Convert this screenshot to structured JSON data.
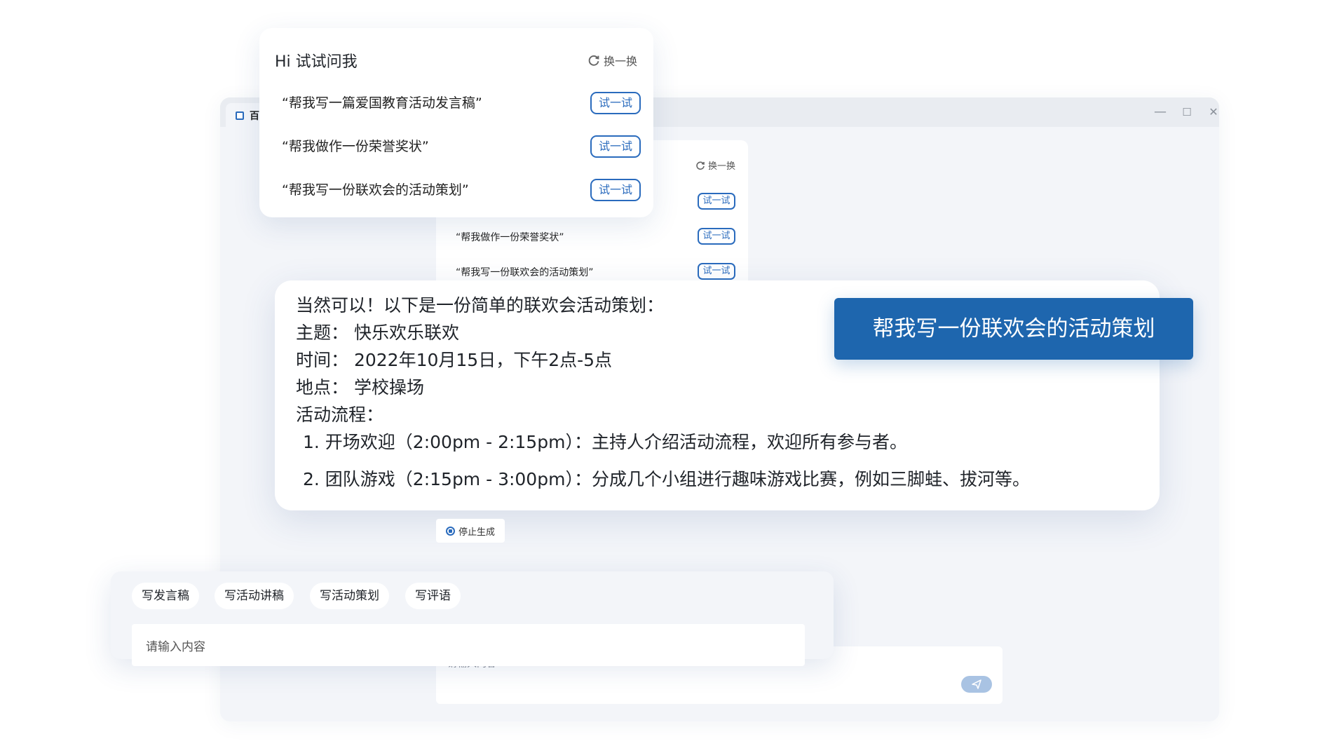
{
  "window": {
    "tab_label": "百",
    "controls": {
      "minimize": "—",
      "maximize": "☐",
      "close": "✕"
    }
  },
  "top_panel": {
    "title": "Hi 试试问我",
    "refresh_label": "换一换",
    "questions": [
      "“帮我写一篇爱国教育活动发言稿”",
      "“帮我做作一份荣誉奖状”",
      "“帮我写一份联欢会的活动策划”"
    ],
    "try_label": "试一试"
  },
  "mid_panel": {
    "refresh_label": "换一换",
    "questions": [
      "“帮我做作一份荣誉奖状”",
      "“帮我写一份联欢会的活动策划”"
    ],
    "try_label": "试一试"
  },
  "user_message": "帮我写一份联欢会的活动策划",
  "answer": {
    "lines": [
      "当然可以！以下是一份简单的联欢会活动策划：",
      "主题： 快乐欢乐联欢",
      "时间： 2022年10月15日，下午2点-5点",
      "地点： 学校操场",
      "活动流程："
    ],
    "items": [
      "1. 开场欢迎（2:00pm - 2:15pm）：主持人介绍活动流程，欢迎所有参与者。",
      "2. 团队游戏（2:15pm - 3:00pm）：分成几个小组进行趣味游戏比赛，例如三脚蛙、拔河等。"
    ]
  },
  "stop_label": "停止生成",
  "back_input": {
    "placeholder": "请输入内容"
  },
  "quick_panel": {
    "chips": [
      "写发言稿",
      "写活动讲稿",
      "写活动策划",
      "写评语"
    ],
    "input_placeholder": "请输入内容"
  },
  "icons": {
    "refresh": "refresh-icon",
    "send": "send-icon",
    "stop": "stop-icon",
    "tab": "app-icon"
  },
  "colors": {
    "accent": "#2a6bbd",
    "bubble": "#1e66ae",
    "background": "#f3f5f9"
  }
}
